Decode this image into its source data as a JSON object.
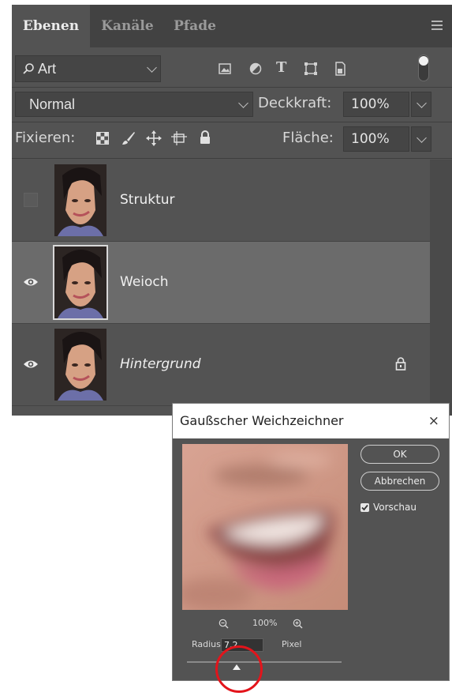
{
  "tabs": [
    {
      "label": "Ebenen",
      "active": true
    },
    {
      "label": "Kanäle",
      "active": false
    },
    {
      "label": "Pfade",
      "active": false
    }
  ],
  "filter": {
    "value": "Art"
  },
  "blend_mode": {
    "value": "Normal"
  },
  "opacity": {
    "label": "Deckkraft:",
    "value": "100%"
  },
  "lock": {
    "label": "Fixieren:"
  },
  "fill": {
    "label": "Fläche:",
    "value": "100%"
  },
  "layers": [
    {
      "name": "Struktur",
      "visible": false,
      "selected": false,
      "locked": false
    },
    {
      "name": "Weioch",
      "visible": true,
      "selected": true,
      "locked": false
    },
    {
      "name": "Hintergrund",
      "visible": true,
      "selected": false,
      "locked": true
    }
  ],
  "dialog": {
    "title": "Gaußscher Weichzeichner",
    "close": "×",
    "ok_label": "OK",
    "cancel_label": "Abbrechen",
    "preview_label": "Vorschau",
    "preview_checked": true,
    "zoom": "100%",
    "radius_label": "Radius:",
    "radius_value": "7,2",
    "radius_unit": "Pixel"
  },
  "colors": {
    "panel": "#535353",
    "tabbar": "#424242",
    "selected_row": "#6b6b6b",
    "highlight_circle": "#e3141b"
  }
}
